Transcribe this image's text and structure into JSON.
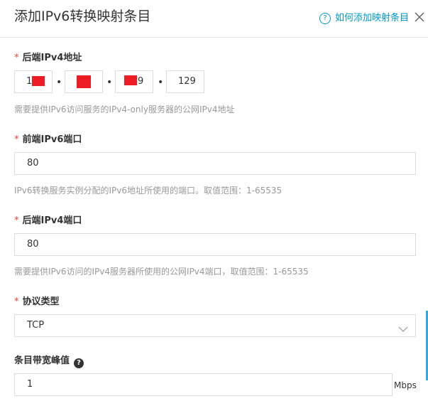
{
  "dialog": {
    "title": "添加IPv6转换映射条目",
    "help_link": "如何添加映射条目",
    "help_icon": "question-circle-icon",
    "close_icon": "close-icon"
  },
  "backend_ipv4": {
    "required_mark": "*",
    "label": "后端IPv4地址",
    "octets": [
      "1",
      "",
      "9",
      "129"
    ],
    "hint": "需要提供IPv6访问服务的IPv4-only服务器的公网IPv4地址"
  },
  "frontend_port": {
    "required_mark": "*",
    "label": "前端IPv6端口",
    "value": "80",
    "hint": "IPv6转换服务实例分配的IPv6地址所使用的端口。取值范围：1-65535"
  },
  "backend_port": {
    "required_mark": "*",
    "label": "后端IPv4端口",
    "value": "80",
    "hint": "需要提供IPv6访问的IPv4服务器所使用的公网IPv4端口，取值范围：1-65535"
  },
  "protocol": {
    "required_mark": "*",
    "label": "协议类型",
    "value": "TCP"
  },
  "bandwidth": {
    "label": "条目带宽峰值",
    "value": "1",
    "unit": "Mbps"
  },
  "colors": {
    "accent": "#0099cc",
    "required": "#f04134",
    "redaction": "#ee1c25"
  }
}
